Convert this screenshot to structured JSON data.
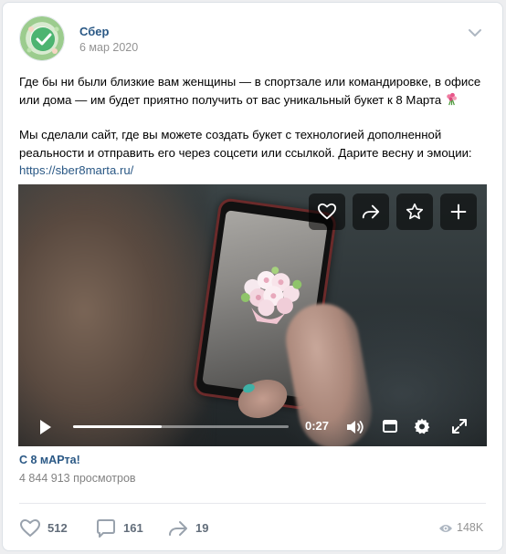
{
  "post": {
    "author": "Сбер",
    "date": "6 мар 2020",
    "text_line1": "Где бы ни были близкие вам женщины — в спортзале или командировке, в офисе или дома — им будет приятно получить от вас уникальный букет к 8 Марта",
    "text_line2": "Мы сделали сайт, где вы можете создать букет с технологией дополненной реальности и отправить его через соцсети или ссылкой. Дарите весну и эмоции:",
    "link": "https://sber8marta.ru/"
  },
  "video": {
    "time": "0:27",
    "progress": 0.41,
    "title": "С 8 мАРта!",
    "views": "4 844 913 просмотров",
    "overlay_buttons": [
      "heart-icon",
      "share-icon",
      "star-icon",
      "plus-icon"
    ],
    "controls": [
      "play-icon",
      "volume-icon",
      "miniplayer-icon",
      "settings-icon",
      "fullscreen-icon"
    ]
  },
  "footer": {
    "likes": "512",
    "comments": "161",
    "shares": "19",
    "views": "148K"
  },
  "colors": {
    "link": "#2a5885",
    "muted": "#939393",
    "action": "#626d7a",
    "background": "#edeef0"
  }
}
